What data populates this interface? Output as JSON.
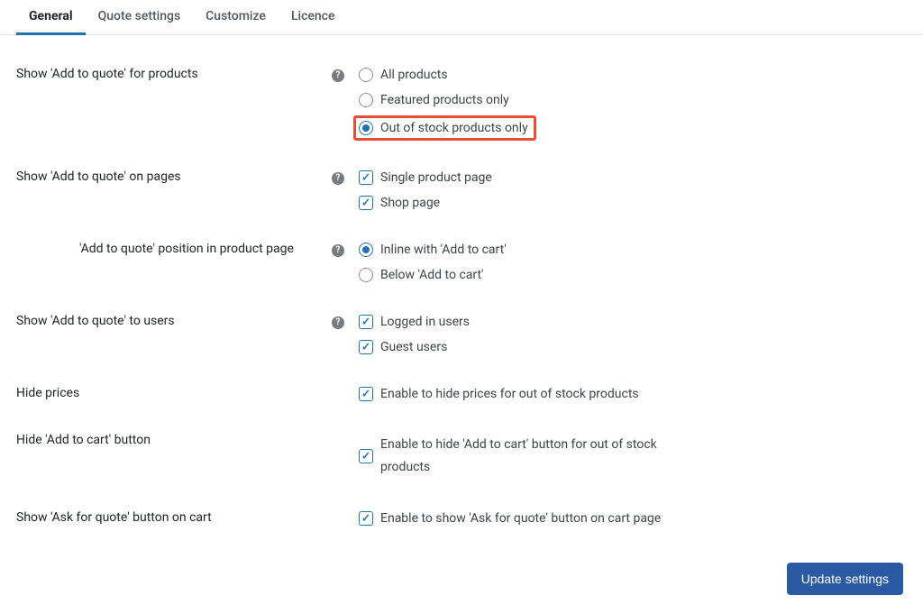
{
  "tabs": [
    {
      "label": "General",
      "active": true
    },
    {
      "label": "Quote settings",
      "active": false
    },
    {
      "label": "Customize",
      "active": false
    },
    {
      "label": "Licence",
      "active": false
    }
  ],
  "fields": {
    "show_for_products": {
      "label": "Show 'Add to quote' for products",
      "options": {
        "all": "All products",
        "featured": "Featured products only",
        "out_of_stock": "Out of stock products only"
      }
    },
    "show_on_pages": {
      "label": "Show 'Add to quote' on pages",
      "options": {
        "single": "Single product page",
        "shop": "Shop page"
      }
    },
    "position": {
      "label": "'Add to quote' position in product page",
      "options": {
        "inline": "Inline with 'Add to cart'",
        "below": "Below 'Add to cart'"
      }
    },
    "show_to_users": {
      "label": "Show 'Add to quote' to users",
      "options": {
        "logged_in": "Logged in users",
        "guest": "Guest users"
      }
    },
    "hide_prices": {
      "label": "Hide prices",
      "option": "Enable to hide prices for out of stock products"
    },
    "hide_add_to_cart": {
      "label": "Hide 'Add to cart' button",
      "option": "Enable to hide 'Add to cart' button for out of stock products"
    },
    "show_ask_on_cart": {
      "label": "Show 'Ask for quote' button on cart",
      "option": "Enable to show 'Ask for quote' button on cart page"
    }
  },
  "button": {
    "update": "Update settings"
  }
}
